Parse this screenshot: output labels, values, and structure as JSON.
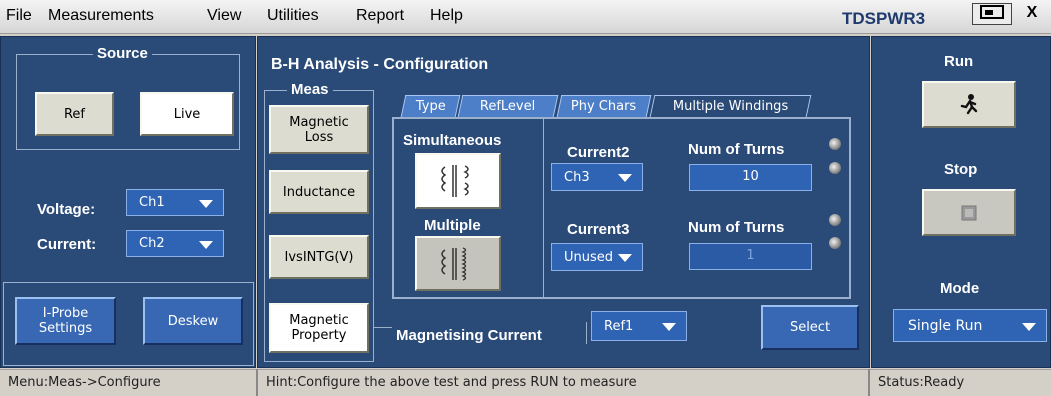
{
  "menubar": {
    "items": [
      "File",
      "Measurements",
      "View",
      "Utilities",
      "Report",
      "Help"
    ],
    "brand": "TDSPWR3",
    "close_label": "X"
  },
  "source": {
    "legend": "Source",
    "ref_label": "Ref",
    "live_label": "Live",
    "voltage_label": "Voltage:",
    "voltage_value": "Ch1",
    "current_label": "Current:",
    "current_value": "Ch2",
    "iprobe_line1": "I-Probe",
    "iprobe_line2": "Settings",
    "deskew_label": "Deskew"
  },
  "config": {
    "title": "B-H Analysis  -  Configuration",
    "meas_legend": "Meas",
    "meas_buttons": [
      {
        "line1": "Magnetic",
        "line2": "Loss"
      },
      {
        "line1": "Inductance",
        "line2": ""
      },
      {
        "line1": "IvsINTG(V)",
        "line2": ""
      },
      {
        "line1": "Magnetic",
        "line2": "Property"
      }
    ],
    "tabs": [
      "Type",
      "RefLevel",
      "Phy Chars",
      "Multiple Windings"
    ],
    "simultaneous_label": "Simultaneous",
    "multiple_label": "Multiple",
    "current2_label": "Current2",
    "current2_value": "Ch3",
    "num_turns_label_1": "Num of Turns",
    "num_turns_value_1": "10",
    "current3_label": "Current3",
    "current3_value": "Unused",
    "num_turns_label_2": "Num of Turns",
    "num_turns_value_2": "1",
    "magnetising_label": "Magnetising Current",
    "magnetising_value": "Ref1",
    "select_label": "Select"
  },
  "control": {
    "run_label": "Run",
    "stop_label": "Stop",
    "mode_label": "Mode",
    "mode_value": "Single Run"
  },
  "statusbar": {
    "menu_path": "Menu:Meas->Configure",
    "hint": "Hint:Configure the above test and press RUN to measure",
    "status": "Status:Ready"
  },
  "icons": [
    "run-man-icon",
    "stop-square-icon",
    "transformer-icon",
    "multi-winding-icon",
    "dropdown-arrow-icon"
  ]
}
